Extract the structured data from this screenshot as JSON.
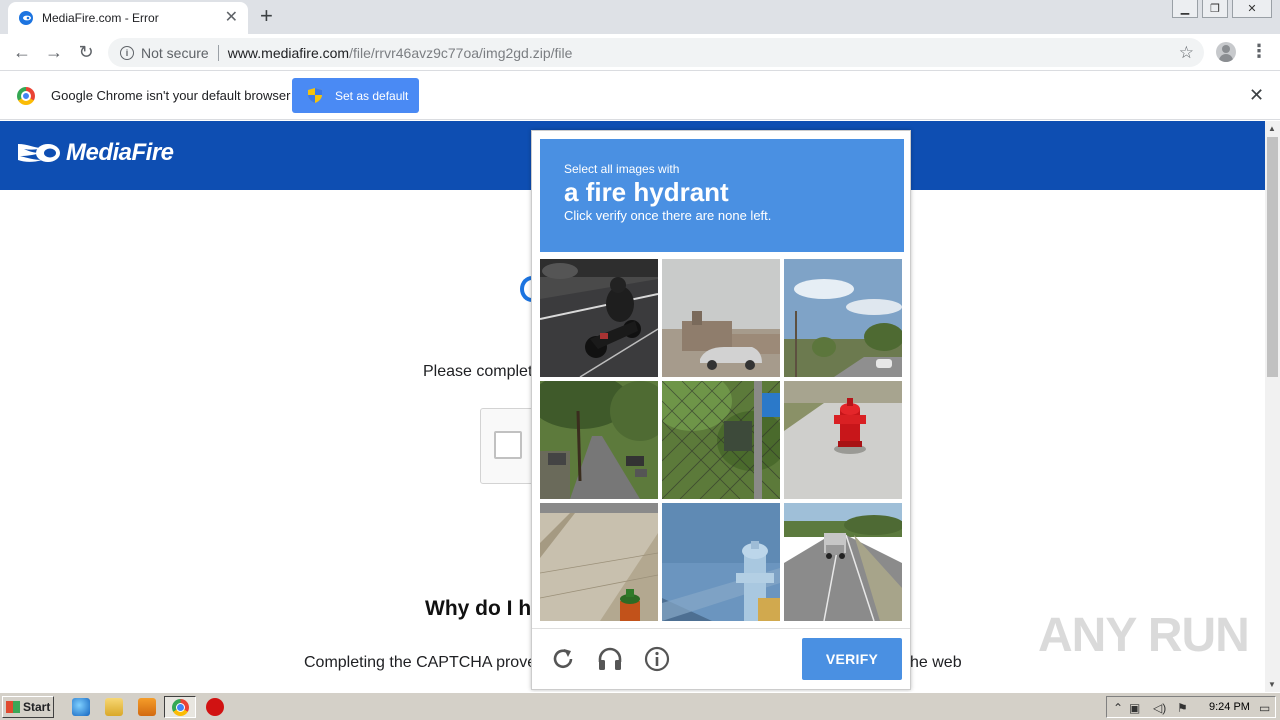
{
  "browser": {
    "tab_title": "MediaFire.com - Error",
    "url_security": "Not secure",
    "url_host": "www.mediafire.com",
    "url_path": "/file/rrvr46avz9c77oa/img2gd.zip/file",
    "infobar_message": "Google Chrome isn't your default browser",
    "set_default_label": "Set as default"
  },
  "page": {
    "logo_text": "MediaFire",
    "text_partial_1": "Please complet",
    "heading_partial": "Why do I h",
    "text_partial_2": "Completing the CAPTCHA prove",
    "text_partial_3": "he web",
    "brand_color": "#0e4eb2"
  },
  "captcha": {
    "line1": "Select all images with",
    "line2": "a fire hydrant",
    "line3": "Click verify once there are none left.",
    "verify_label": "VERIFY",
    "accent_color": "#4a90e2",
    "tiles": [
      {
        "name": "tile-motorcycle",
        "desc": "motorcycle"
      },
      {
        "name": "tile-street-buildings",
        "desc": "street buildings"
      },
      {
        "name": "tile-road-sky",
        "desc": "road sky"
      },
      {
        "name": "tile-tree-street",
        "desc": "tree street"
      },
      {
        "name": "tile-fence-sign",
        "desc": "fence sign"
      },
      {
        "name": "tile-red-hydrant",
        "desc": "red hydrant"
      },
      {
        "name": "tile-sidewalk-hydrant",
        "desc": "sidewalk hydrant"
      },
      {
        "name": "tile-blue-hydrant",
        "desc": "blue hydrant"
      },
      {
        "name": "tile-highway-truck",
        "desc": "highway truck"
      }
    ]
  },
  "watermark": "ANY RUN",
  "taskbar": {
    "start_label": "Start",
    "clock": "9:24 PM"
  }
}
